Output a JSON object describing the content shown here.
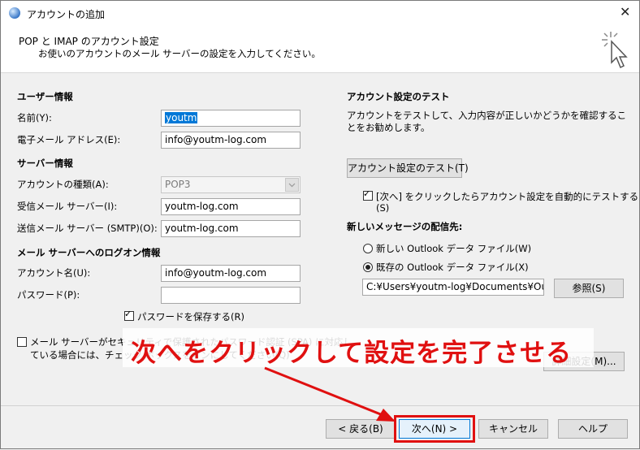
{
  "window": {
    "title": "アカウントの追加",
    "close_glyph": "✕"
  },
  "header": {
    "title": "POP と IMAP のアカウント設定",
    "subtitle": "お使いのアカウントのメール サーバーの設定を入力してください。"
  },
  "user_info": {
    "section": "ユーザー情報",
    "name_label": "名前(Y):",
    "name_value": "youtm",
    "email_label": "電子メール アドレス(E):",
    "email_value": "info@youtm-log.com"
  },
  "server_info": {
    "section": "サーバー情報",
    "account_type_label": "アカウントの種類(A):",
    "account_type_value": "POP3",
    "incoming_label": "受信メール サーバー(I):",
    "incoming_value": "youtm-log.com",
    "outgoing_label": "送信メール サーバー (SMTP)(O):",
    "outgoing_value": "youtm-log.com"
  },
  "logon_info": {
    "section": "メール サーバーへのログオン情報",
    "account_name_label": "アカウント名(U):",
    "account_name_value": "info@youtm-log.com",
    "password_label": "パスワード(P):",
    "password_value": "",
    "remember_password_label": "パスワードを保存する(R)",
    "remember_password_checked": true,
    "spa_line1": "メール サーバーがセキュリティで保護されたパスワード認証 (SPA) に対応し",
    "spa_line2": "ている場合には、チェック ボックスをオンにしてください(Q)",
    "spa_checked": false
  },
  "test": {
    "section": "アカウント設定のテスト",
    "description": "アカウントをテストして、入力内容が正しいかどうかを確認することをお勧めします。",
    "test_button": "アカウント設定のテスト(T)",
    "auto_test_label": "[次へ] をクリックしたらアカウント設定を自動的にテストする",
    "auto_test_label2": "(S)",
    "auto_test_checked": true
  },
  "delivery": {
    "section": "新しいメッセージの配信先:",
    "new_file_label": "新しい Outlook データ ファイル(W)",
    "existing_file_label": "既存の Outlook データ ファイル(X)",
    "selected": "existing",
    "path_value": "C:¥Users¥youtm-log¥Documents¥Out",
    "browse_button": "参照(S)"
  },
  "more_settings_button": "詳細設定(M)...",
  "footer": {
    "back_button": "< 戻る(B)",
    "next_button": "次へ(N) >",
    "cancel_button": "キャンセル",
    "help_button": "ヘルプ"
  },
  "annotation": {
    "text": "次へをクリックして設定を完了させる",
    "color": "#e01010"
  }
}
